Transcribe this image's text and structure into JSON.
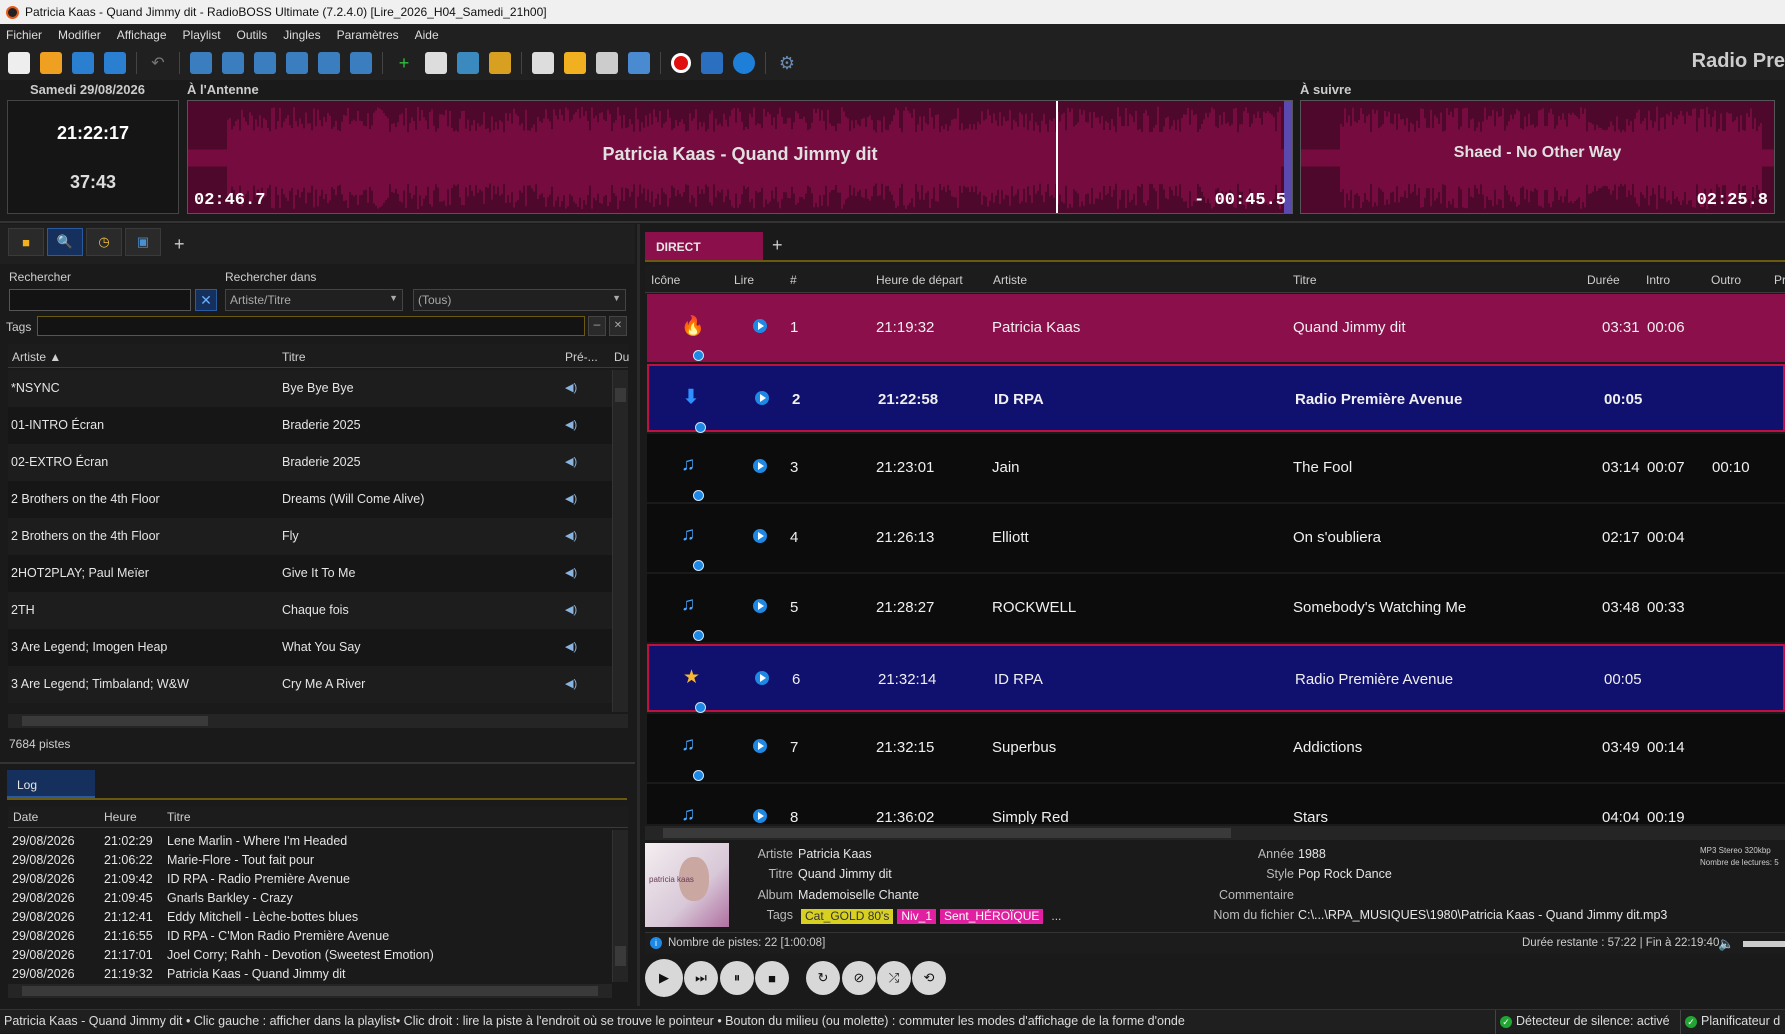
{
  "window": {
    "title": "Patricia Kaas - Quand Jimmy dit - RadioBOSS Ultimate (7.2.4.0) [Lire_2026_H04_Samedi_21h00]"
  },
  "menu": [
    "Fichier",
    "Modifier",
    "Affichage",
    "Playlist",
    "Outils",
    "Jingles",
    "Paramètres",
    "Aide"
  ],
  "radio_name": "Radio Pre",
  "header": {
    "date": "Samedi 29/08/2026",
    "on_air_label": "À l'Antenne",
    "next_label": "À suivre",
    "clock": "21:22:17",
    "countdown": "37:43",
    "current_track": "Patricia Kaas - Quand Jimmy dit",
    "current_elapsed": "02:46.7",
    "current_remaining": "- 00:45.5",
    "next_track": "Shaed - No Other Way",
    "next_duration": "02:25.8",
    "waveform_color": "#8a0f4a"
  },
  "library": {
    "search_label": "Rechercher",
    "search_value": "",
    "search_in_label": "Rechercher dans",
    "search_in_value": "Artiste/Titre",
    "filter_value": "(Tous)",
    "tags_label": "Tags",
    "columns": [
      "Artiste",
      "Titre",
      "Pré-...",
      "Du"
    ],
    "rows": [
      {
        "artist": "*NSYNC",
        "title": "Bye Bye Bye"
      },
      {
        "artist": "01-INTRO Écran",
        "title": "Braderie 2025"
      },
      {
        "artist": "02-EXTRO Écran",
        "title": "Braderie 2025"
      },
      {
        "artist": "2 Brothers on the 4th Floor",
        "title": "Dreams (Will Come Alive)"
      },
      {
        "artist": "2 Brothers on the 4th Floor",
        "title": "Fly"
      },
      {
        "artist": "2HOT2PLAY; Paul Meïer",
        "title": "Give It To Me"
      },
      {
        "artist": "2TH",
        "title": "Chaque fois"
      },
      {
        "artist": "3 Are Legend; Imogen Heap",
        "title": "What You Say"
      },
      {
        "artist": "3 Are Legend; Timbaland; W&W",
        "title": "Cry Me A River"
      }
    ],
    "count": "7684 pistes"
  },
  "log": {
    "tab": "Log",
    "columns": [
      "Date",
      "Heure",
      "Titre"
    ],
    "rows": [
      {
        "date": "29/08/2026",
        "time": "21:02:29",
        "title": "Lene Marlin - Where I'm Headed"
      },
      {
        "date": "29/08/2026",
        "time": "21:06:22",
        "title": "Marie-Flore - Tout fait pour"
      },
      {
        "date": "29/08/2026",
        "time": "21:09:42",
        "title": "ID RPA - Radio Première Avenue"
      },
      {
        "date": "29/08/2026",
        "time": "21:09:45",
        "title": "Gnarls Barkley - Crazy"
      },
      {
        "date": "29/08/2026",
        "time": "21:12:41",
        "title": "Eddy Mitchell - Lèche-bottes blues"
      },
      {
        "date": "29/08/2026",
        "time": "21:16:55",
        "title": "ID RPA - C'Mon Radio Première Avenue"
      },
      {
        "date": "29/08/2026",
        "time": "21:17:01",
        "title": "Joel Corry; Rahh - Devotion (Sweetest Emotion)"
      },
      {
        "date": "29/08/2026",
        "time": "21:19:32",
        "title": "Patricia Kaas - Quand Jimmy dit"
      }
    ]
  },
  "playlist": {
    "tab": "DIRECT",
    "columns": [
      "Icône",
      "Lire",
      "#",
      "Heure de départ",
      "Artiste",
      "Titre",
      "Durée",
      "Intro",
      "Outro",
      "Pr"
    ],
    "rows": [
      {
        "icon": "flame-icon",
        "glyph": "🔥",
        "num": "1",
        "start": "21:19:32",
        "artist": "Patricia Kaas",
        "title": "Quand Jimmy dit",
        "duration": "03:31",
        "intro": "00:06",
        "outro": "",
        "state": "playing"
      },
      {
        "icon": "arrow-down-icon",
        "glyph": "⬇",
        "num": "2",
        "start": "21:22:58",
        "artist": "ID RPA",
        "title": "Radio Première Avenue",
        "duration": "00:05",
        "intro": "",
        "outro": "",
        "state": "jingle-bold"
      },
      {
        "icon": "music-note-icon",
        "glyph": "♫",
        "num": "3",
        "start": "21:23:01",
        "artist": "Jain",
        "title": "The Fool",
        "duration": "03:14",
        "intro": "00:07",
        "outro": "00:10",
        "state": "normal"
      },
      {
        "icon": "music-note-icon",
        "glyph": "♫",
        "num": "4",
        "start": "21:26:13",
        "artist": "Elliott",
        "title": "On s'oubliera",
        "duration": "02:17",
        "intro": "00:04",
        "outro": "",
        "state": "normal"
      },
      {
        "icon": "music-note-icon",
        "glyph": "♫",
        "num": "5",
        "start": "21:28:27",
        "artist": "ROCKWELL",
        "title": "Somebody's Watching Me",
        "duration": "03:48",
        "intro": "00:33",
        "outro": "",
        "state": "normal"
      },
      {
        "icon": "star-icon",
        "glyph": "★",
        "num": "6",
        "start": "21:32:14",
        "artist": "ID RPA",
        "title": "Radio Première Avenue",
        "duration": "00:05",
        "intro": "",
        "outro": "",
        "state": "jingle"
      },
      {
        "icon": "music-note-icon",
        "glyph": "♫",
        "num": "7",
        "start": "21:32:15",
        "artist": "Superbus",
        "title": "Addictions",
        "duration": "03:49",
        "intro": "00:14",
        "outro": "",
        "state": "normal"
      },
      {
        "icon": "music-note-icon",
        "glyph": "♫",
        "num": "8",
        "start": "21:36:02",
        "artist": "Simply Red",
        "title": "Stars",
        "duration": "04:04",
        "intro": "00:19",
        "outro": "",
        "state": "normal"
      }
    ],
    "count": "Nombre de pistes: 22 [1:00:08]",
    "remaining": "Durée restante : 57:22 | Fin à 22:19:40"
  },
  "track_info": {
    "labels": {
      "artist": "Artiste",
      "title": "Titre",
      "album": "Album",
      "tags": "Tags",
      "year": "Année",
      "style": "Style",
      "comment": "Commentaire",
      "filename": "Nom du fichier"
    },
    "artist": "Patricia Kaas",
    "title": "Quand Jimmy dit",
    "album": "Mademoiselle Chante",
    "year": "1988",
    "style": "Pop Rock Dance",
    "comment": "",
    "filename": "C:\\...\\RPA_MUSIQUES\\1980\\Patricia Kaas - Quand Jimmy dit.mp3",
    "tags": [
      "Cat_GOLD 80's",
      "Niv_1",
      "Sent_HÉROÏQUE",
      "..."
    ],
    "format": "MP3 Stereo 320kbp",
    "plays": "Nombre de lectures: 5",
    "cover_text": "patricia kaas"
  },
  "status": {
    "hint": "Patricia Kaas - Quand Jimmy dit • Clic gauche : afficher dans la playlist• Clic droit : lire la piste à l'endroit où se trouve le pointeur • Bouton du milieu (ou molette) : commuter les modes d'affichage de la forme d'onde",
    "silence": "Détecteur de silence: activé",
    "scheduler": "Planificateur d"
  },
  "colors": {
    "accent": "#8a0f4a",
    "selection": "#10106e",
    "tab_active": "#8a0f4a"
  }
}
